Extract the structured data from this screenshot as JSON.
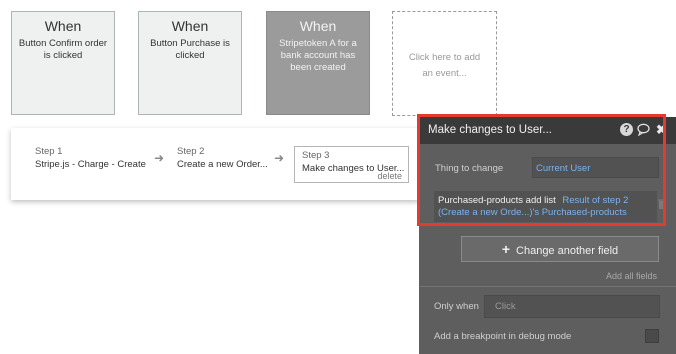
{
  "events": [
    {
      "when": "When",
      "desc": "Button Confirm order is clicked"
    },
    {
      "when": "When",
      "desc": "Button Purchase is clicked"
    },
    {
      "when": "When",
      "desc": "Stripetoken A for a bank account has been created"
    }
  ],
  "add_event": "Click here to add an event...",
  "steps": [
    {
      "num": "Step 1",
      "name": "Stripe.js - Charge - Create"
    },
    {
      "num": "Step 2",
      "name": "Create a new Order..."
    },
    {
      "num": "Step 3",
      "name": "Make changes to User...",
      "delete": "delete"
    }
  ],
  "panel": {
    "title": "Make changes to User...",
    "thing_label": "Thing to change",
    "thing_value": "Current User",
    "field_key": "Purchased-products add list",
    "field_value_1": "Result of step 2",
    "field_value_2": "(Create a new Orde...)'s Purchased-products",
    "change_button": "Change another field",
    "add_all": "Add all fields",
    "only_when_label": "Only when",
    "only_when_placeholder": "Click",
    "breakpoint_label": "Add a breakpoint in debug mode"
  },
  "colors": {
    "highlight": "#e53a2f",
    "link": "#79b3f0",
    "panel": "#5e5e5e",
    "header": "#3a3a3a"
  },
  "icons": [
    "help-icon",
    "comment-icon",
    "close-icon",
    "trash-icon",
    "plus-icon",
    "arrow-right-icon"
  ]
}
